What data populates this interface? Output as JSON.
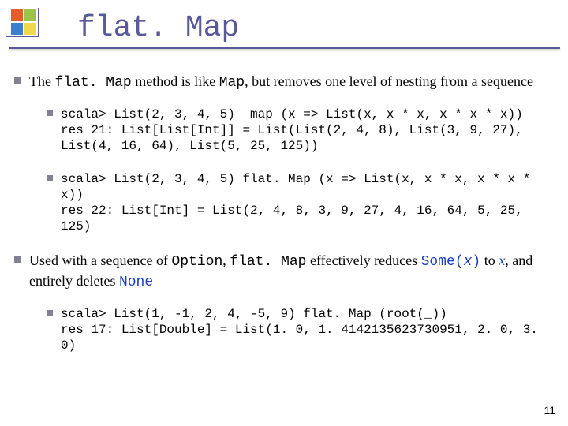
{
  "title": "flat. Map",
  "bullet1": {
    "pre": "The ",
    "method": "flat. Map",
    "mid": " method is like ",
    "map": "Map",
    "post": ", but removes one level of nesting from a sequence"
  },
  "code1": "scala> List(2, 3, 4, 5)  map (x => List(x, x * x, x * x * x))\nres 21: List[List[Int]] = List(List(2, 4, 8), List(3, 9, 27), List(4, 16, 64), List(5, 25, 125))",
  "code2": "scala> List(2, 3, 4, 5) flat. Map (x => List(x, x * x, x * x * x))\nres 22: List[Int] = List(2, 4, 8, 3, 9, 27, 4, 16, 64, 5, 25, 125)",
  "bullet2": {
    "pre": "Used with a sequence of ",
    "option": "Option",
    "mid1": ", ",
    "flatmap": "flat. Map",
    "mid2": " effectively reduces ",
    "some_open": "Some(",
    "some_x": "x",
    "some_close": ")",
    "mid3": " to ",
    "x": "x",
    "mid4": ", and entirely deletes ",
    "none": "None"
  },
  "code3": "scala> List(1, -1, 2, 4, -5, 9) flat. Map (root(_))\nres 17: List[Double] = List(1. 0, 1. 4142135623730951, 2. 0, 3. 0)",
  "page_number": "11"
}
